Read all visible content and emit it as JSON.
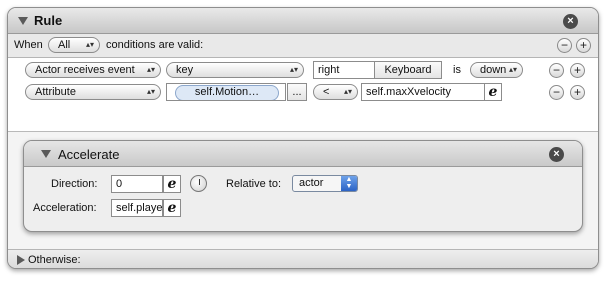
{
  "rule": {
    "title": "Rule",
    "when_label": "When",
    "when_value": "All",
    "conditions_label": "conditions are valid:",
    "rows": [
      {
        "trigger": "Actor receives event",
        "key_type": "key",
        "key_value": "right",
        "device_button": "Keyboard",
        "is_label": "is",
        "state": "down"
      },
      {
        "trigger": "Attribute",
        "attribute": "self.Motion…",
        "ellipsis": "...",
        "operator": "<",
        "compare_value": "self.maxXvelocity"
      }
    ],
    "otherwise_label": "Otherwise:"
  },
  "accelerate": {
    "title": "Accelerate",
    "direction_label": "Direction:",
    "direction_value": "0",
    "relative_label": "Relative to:",
    "relative_value": "actor",
    "acceleration_label": "Acceleration:",
    "acceleration_value": "self.player"
  },
  "icons": {
    "close": "×",
    "add": "+",
    "remove": "−",
    "expression_editor": "e",
    "popup_arrows": "▴▾"
  },
  "colors": {
    "accent_blue": "#2c63c5",
    "pill_blue": "#dde8f6"
  }
}
